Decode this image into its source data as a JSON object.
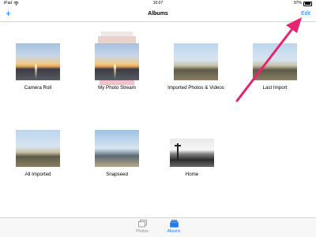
{
  "status": {
    "left": "iPad",
    "time": "16:07",
    "battery": "97%"
  },
  "nav": {
    "add": "+",
    "title": "Albums",
    "edit": "Edit"
  },
  "albums": [
    {
      "label": "Camera Roll"
    },
    {
      "label": "My Photo Stream"
    },
    {
      "label": "Imported Photos & Videos"
    },
    {
      "label": "Last Import"
    },
    {
      "label": "All Imported"
    },
    {
      "label": "Snapseed"
    },
    {
      "label": "Home"
    }
  ],
  "tabs": [
    {
      "label": "Photos",
      "active": false
    },
    {
      "label": "Albums",
      "active": true
    }
  ],
  "colors": {
    "accent": "#1c7bf6",
    "arrow": "#e8236f",
    "inactive": "#8e8e93"
  }
}
